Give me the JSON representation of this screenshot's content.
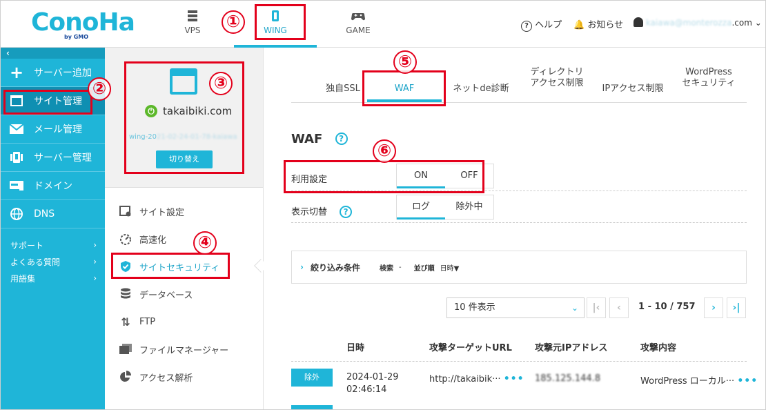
{
  "header": {
    "logo": "ConoHa",
    "logo_sub": "by GMO",
    "tabs": [
      {
        "label": "VPS",
        "icon": "server-icon"
      },
      {
        "label": "WING",
        "icon": "wing-icon"
      },
      {
        "label": "GAME",
        "icon": "gamepad-icon"
      }
    ],
    "help_label": "ヘルプ",
    "notice_label": "お知らせ",
    "account_blurred": "kaiawa@monterozza",
    "account_suffix": ".com"
  },
  "annotations": [
    "①",
    "②",
    "③",
    "④",
    "⑤",
    "⑥"
  ],
  "sidebar": {
    "collapse": "‹",
    "items": [
      {
        "label": "サーバー追加",
        "icon": "plus-icon"
      },
      {
        "label": "サイト管理",
        "icon": "window-icon"
      },
      {
        "label": "メール管理",
        "icon": "mail-icon"
      },
      {
        "label": "サーバー管理",
        "icon": "server-icon"
      },
      {
        "label": "ドメイン",
        "icon": "domain-icon"
      },
      {
        "label": "DNS",
        "icon": "globe-icon"
      }
    ],
    "links": [
      {
        "label": "サポート",
        "chevron": "›"
      },
      {
        "label": "よくある質問",
        "chevron": "›"
      },
      {
        "label": "用語集",
        "chevron": "›"
      }
    ]
  },
  "site_card": {
    "domain": "takaibiki.com",
    "wing_prefix": "wing-20",
    "wing_blurred": "21-02-24-01-78-kaiawa",
    "switch_label": "切り替え"
  },
  "site_menu": [
    {
      "label": "サイト設定",
      "icon": "site-settings-icon"
    },
    {
      "label": "高速化",
      "icon": "speed-icon"
    },
    {
      "label": "サイトセキュリティ",
      "icon": "shield-icon"
    },
    {
      "label": "データベース",
      "icon": "database-icon"
    },
    {
      "label": "FTP",
      "icon": "transfer-icon"
    },
    {
      "label": "ファイルマネージャー",
      "icon": "folder-icon"
    },
    {
      "label": "アクセス解析",
      "icon": "pie-chart-icon"
    }
  ],
  "subtabs": [
    {
      "line1": "独自SSL",
      "line2": ""
    },
    {
      "line1": "WAF",
      "line2": ""
    },
    {
      "line1": "ネットde診断",
      "line2": ""
    },
    {
      "line1": "ディレクトリ",
      "line2": "アクセス制限"
    },
    {
      "line1": "IPアクセス制限",
      "line2": ""
    },
    {
      "line1": "WordPress",
      "line2": "セキュリティ"
    }
  ],
  "waf": {
    "title": "WAF",
    "help": "?",
    "usage_label": "利用設定",
    "usage_on": "ON",
    "usage_off": "OFF",
    "display_label": "表示切替",
    "display_log": "ログ",
    "display_excluded": "除外中"
  },
  "filter": {
    "title": "絞り込み条件",
    "search_label": "検索",
    "search_value": "-",
    "sort_label": "並び順",
    "sort_value": "日時▼"
  },
  "pagination": {
    "per_page": "10 件表示",
    "first": "|‹",
    "prev": "‹",
    "range": "1  - 10 / 757",
    "next": "›",
    "last": "›|"
  },
  "table": {
    "headers": [
      "日時",
      "攻撃ターゲットURL",
      "攻撃元IPアドレス",
      "攻撃内容"
    ],
    "rows": [
      {
        "action": "除外",
        "date": "2024-01-29",
        "time": "02:46:14",
        "url": "http://takaibik···",
        "ip_blurred": "185.125.144.8",
        "content": "WordPress ローカル···"
      }
    ]
  }
}
